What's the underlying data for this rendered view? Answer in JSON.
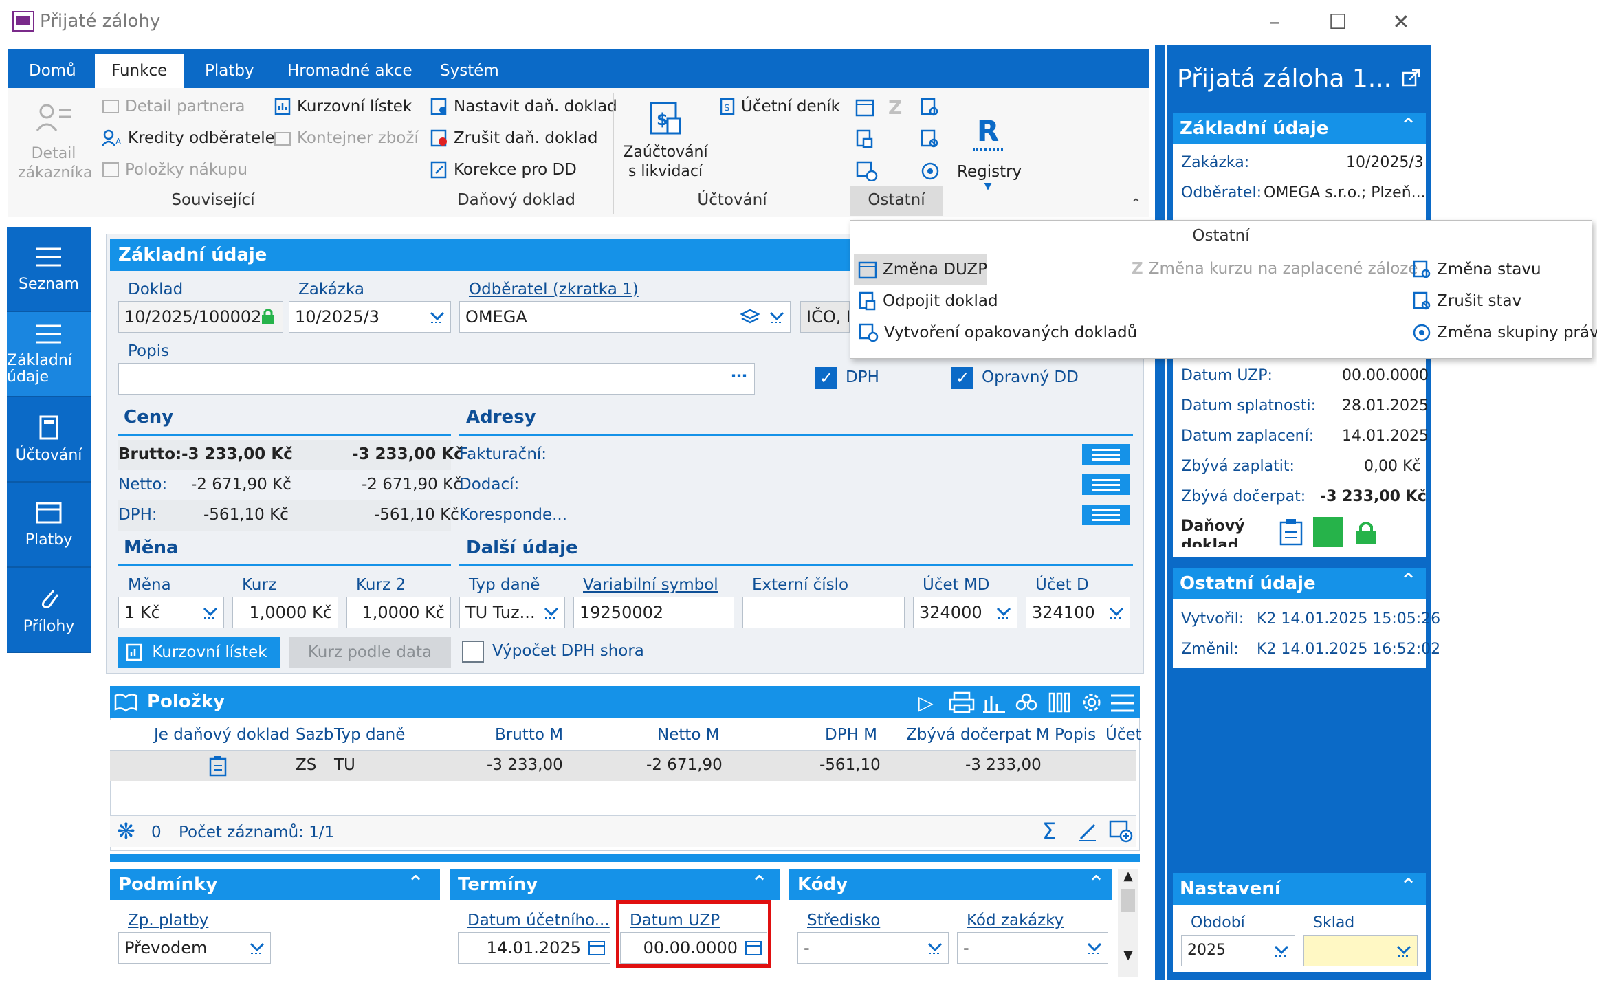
{
  "window": {
    "title": "Přijaté zálohy"
  },
  "tabs": [
    "Domů",
    "Funkce",
    "Platby",
    "Hromadné akce",
    "Systém"
  ],
  "ribbon": {
    "detail_zakaznika": "Detail zákazníka",
    "detail_partnera": "Detail partnera",
    "kredity": "Kredity odběratele",
    "polozky_nakupu": "Položky nákupu",
    "kurzovni_listek": "Kurzovní lístek",
    "kontejner": "Kontejner zboží",
    "souvisejici": "Související",
    "nastavit": "Nastavit daň. doklad",
    "zrusit": "Zrušit daň. doklad",
    "korekce": "Korekce pro DD",
    "danovy_doklad": "Daňový doklad",
    "zauctovani": "Zaúčtování s likvidací",
    "ucetni_denik": "Účetní deník",
    "uctovani": "Účtování",
    "ostatni": "Ostatní",
    "registry": "Registry"
  },
  "sidenav": [
    "Seznam",
    "Základní údaje",
    "Účtování",
    "Platby",
    "Přílohy"
  ],
  "form": {
    "header": "Základní údaje",
    "doklad_lbl": "Doklad",
    "doklad": "10/2025/100002",
    "zakazka_lbl": "Zakázka",
    "zakazka": "10/2025/3",
    "odberatel_lbl": "Odběratel (zkratka 1)",
    "odberatel": "OMEGA",
    "ico": "IČO, D",
    "popis_lbl": "Popis",
    "dph": "DPH",
    "opravny": "Opravný DD",
    "ceny": "Ceny",
    "adresy": "Adresy",
    "brutto_lbl": "Brutto:",
    "brutto1": "-3 233,00 Kč",
    "brutto2": "-3 233,00 Kč",
    "netto_lbl": "Netto:",
    "netto1": "-2 671,90 Kč",
    "netto2": "-2 671,90 Kč",
    "dph_lbl": "DPH:",
    "dph1": "-561,10 Kč",
    "dph2": "-561,10 Kč",
    "fakturacni": "Fakturační:",
    "dodaci": "Dodací:",
    "korespond": "Koresponde...",
    "mena_hdr": "Měna",
    "dalsi": "Další údaje",
    "mena_lbl": "Měna",
    "mena": "1 Kč",
    "kurz_lbl": "Kurz",
    "kurz": "1,0000 Kč",
    "kurz2_lbl": "Kurz 2",
    "kurz2": "1,0000 Kč",
    "typdane_lbl": "Typ daně",
    "typdane": "TU Tuz...",
    "vs_lbl": "Variabilní symbol",
    "vs": "19250002",
    "ext_lbl": "Externí číslo",
    "md_lbl": "Účet MD",
    "md": "324000",
    "d_lbl": "Účet D",
    "d": "324100",
    "kurzovni_btn": "Kurzovní lístek",
    "kurz_podle": "Kurz podle data",
    "vypocet": "Výpočet DPH shora"
  },
  "polozky": {
    "title": "Položky",
    "cols": [
      "Je daňový doklad",
      "Sazb",
      "Typ daně",
      "Brutto M",
      "Netto M",
      "DPH M",
      "Zbývá dočerpat M",
      "Popis",
      "Účet"
    ],
    "row": {
      "sazba": "ZS",
      "typ": "TU",
      "brutto": "-3 233,00",
      "netto": "-2 671,90",
      "dph": "-561,10",
      "zbyva": "-3 233,00"
    },
    "count_zero": "0",
    "count": "Počet záznamů: 1/1"
  },
  "bottom": {
    "podminky": "Podmínky",
    "zp_lbl": "Zp. platby",
    "zp": "Převodem",
    "terminy": "Termíny",
    "datum_uc_lbl": "Datum účetního...",
    "datum_uc": "14.01.2025",
    "uzp_lbl": "Datum UZP",
    "uzp": "00.00.0000",
    "kody": "Kódy",
    "stredisko_lbl": "Středisko",
    "stredisko": "-",
    "kod_lbl": "Kód zakázky",
    "kod": "-"
  },
  "right": {
    "title": "Přijatá záloha 1...",
    "zakladni": "Základní údaje",
    "zakazka_lbl": "Zakázka:",
    "zakazka": "10/2025/3",
    "odberatel_lbl": "Odběratel:",
    "odberatel": "OMEGA s.r.o.; Plzeň...",
    "uzp_lbl": "Datum UZP:",
    "uzp": "00.00.0000",
    "splat_lbl": "Datum splatnosti:",
    "splat": "28.01.2025",
    "zapl_lbl": "Datum zaplacení:",
    "zapl": "14.01.2025",
    "zbyva_lbl": "Zbývá zaplatit:",
    "zbyva": "0,00 Kč",
    "docerpat_lbl": "Zbývá dočerpat:",
    "docerpat": "-3 233,00 Kč",
    "danovy": "Daňový doklad",
    "ostatni": "Ostatní údaje",
    "vytvoril_lbl": "Vytvořil:",
    "vytvoril": "K2 14.01.2025 15:05:26",
    "zmenil_lbl": "Změnil:",
    "zmenil": "K2 14.01.2025 16:52:02",
    "nastaveni": "Nastavení",
    "obdobi_lbl": "Období",
    "obdobi": "2025",
    "sklad_lbl": "Sklad"
  },
  "popup": {
    "title": "Ostatní",
    "zmena_duzp": "Změna DUZP",
    "odpojit": "Odpojit doklad",
    "vytvoreni": "Vytvoření opakovaných dokladů",
    "zmena_kurzu": "Změna kurzu na zaplacené záloze",
    "zmena_stavu": "Změna stavu",
    "zrusit_stav": "Zrušit stav",
    "zmena_skupiny": "Změna skupiny práv"
  },
  "colors": {
    "accent": "#1592e8",
    "nav": "#0b6ac7",
    "highlight": "#e01010",
    "ok": "#26b34a"
  }
}
